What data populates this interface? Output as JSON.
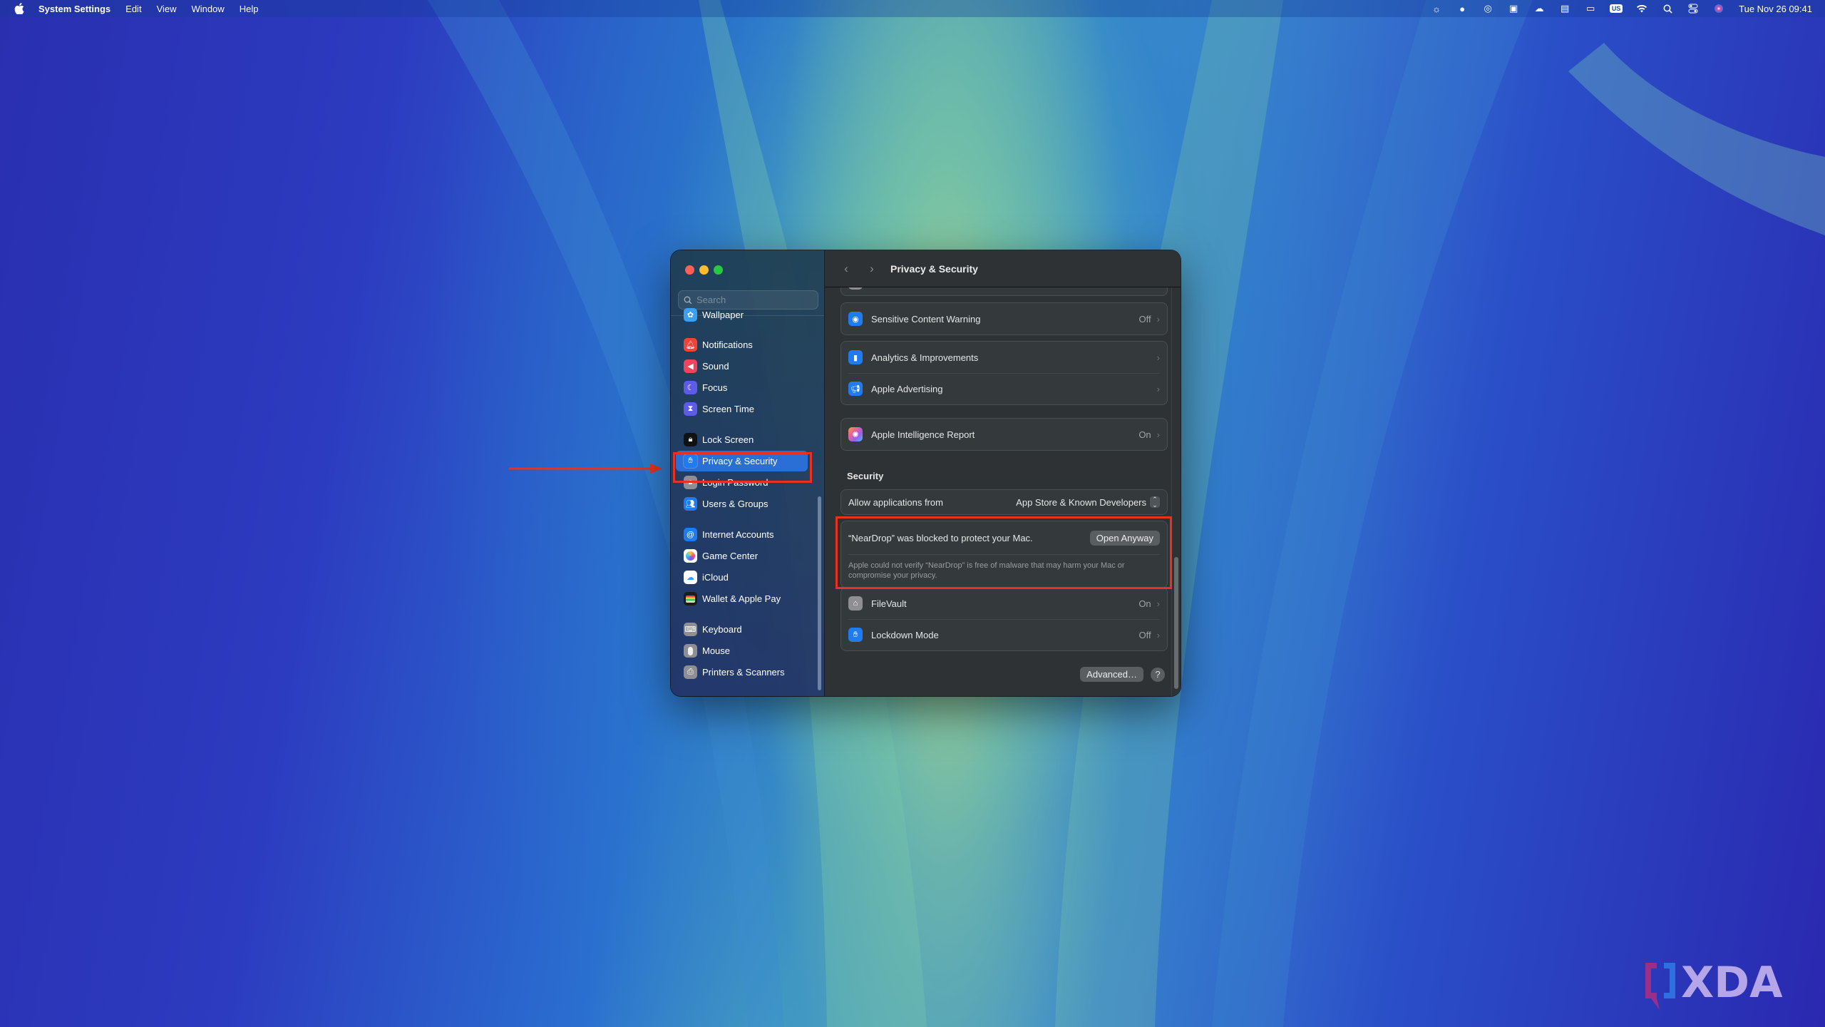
{
  "menubar": {
    "app_name": "System Settings",
    "menus": [
      "Edit",
      "View",
      "Window",
      "Help"
    ],
    "status_icons": [
      "brightness-icon",
      "balloon-icon",
      "creative-cloud-icon",
      "window-layout-icon",
      "onedrive-cloud-icon",
      "drive-icon",
      "display-icon",
      "keyboard-input-us-icon",
      "wifi-icon",
      "spotlight-search-icon",
      "control-center-icon",
      "siri-icon"
    ],
    "input_source": "US",
    "clock": "Tue Nov 26  09:41"
  },
  "window": {
    "title": "Privacy & Security",
    "sidebar": {
      "search_placeholder": "Search",
      "items": [
        {
          "label": "Wallpaper",
          "icon": "wallpaper-icon",
          "color": "#3aa0ef"
        },
        {
          "label": "Notifications",
          "icon": "notifications-icon",
          "color": "#f0443a"
        },
        {
          "label": "Sound",
          "icon": "sound-icon",
          "color": "#f0445e"
        },
        {
          "label": "Focus",
          "icon": "focus-moon-icon",
          "color": "#5e5ce6"
        },
        {
          "label": "Screen Time",
          "icon": "hourglass-icon",
          "color": "#5e5ce6"
        },
        {
          "label": "Lock Screen",
          "icon": "lock-screen-icon",
          "color": "#1c1c1e"
        },
        {
          "label": "Privacy & Security",
          "icon": "hand-icon",
          "color": "#1e7cf0",
          "selected": true
        },
        {
          "label": "Login Password",
          "icon": "lock-icon",
          "color": "#8e8e93"
        },
        {
          "label": "Users & Groups",
          "icon": "users-icon",
          "color": "#1e7cf0"
        },
        {
          "label": "Internet Accounts",
          "icon": "at-sign-icon",
          "color": "#1e7cf0"
        },
        {
          "label": "Game Center",
          "icon": "game-center-icon",
          "color": "#ffffff"
        },
        {
          "label": "iCloud",
          "icon": "icloud-icon",
          "color": "#ffffff"
        },
        {
          "label": "Wallet & Apple Pay",
          "icon": "wallet-icon",
          "color": "#1c1c1e"
        },
        {
          "label": "Keyboard",
          "icon": "keyboard-icon",
          "color": "#8e8e93"
        },
        {
          "label": "Mouse",
          "icon": "mouse-icon",
          "color": "#8e8e93"
        },
        {
          "label": "Printers & Scanners",
          "icon": "printer-icon",
          "color": "#8e8e93"
        }
      ]
    },
    "main": {
      "rows_top": [
        {
          "label": "Sensitive Content Warning",
          "value": "Off",
          "icon": "eye-warning-icon",
          "color": "#1e7cf0"
        }
      ],
      "rows_analytics": [
        {
          "label": "Analytics & Improvements",
          "value": "",
          "icon": "chart-bars-icon",
          "color": "#1e7cf0"
        },
        {
          "label": "Apple Advertising",
          "value": "",
          "icon": "megaphone-icon",
          "color": "#1e7cf0"
        }
      ],
      "rows_intelligence": [
        {
          "label": "Apple Intelligence Report",
          "value": "On",
          "icon": "apple-intelligence-icon",
          "color": "#e8649a"
        }
      ],
      "security_section": {
        "title": "Security",
        "allow_label": "Allow applications from",
        "allow_value": "App Store & Known Developers",
        "blocked_message": "“NearDrop” was blocked to protect your Mac.",
        "open_anyway_label": "Open Anyway",
        "blocked_description": "Apple could not verify “NearDrop” is free of malware that may harm your Mac or compromise your privacy."
      },
      "rows_security": [
        {
          "label": "FileVault",
          "value": "On",
          "icon": "filevault-house-icon",
          "color": "#8e8e93"
        },
        {
          "label": "Lockdown Mode",
          "value": "Off",
          "icon": "hand-icon",
          "color": "#1e7cf0"
        }
      ],
      "advanced_label": "Advanced…",
      "help_label": "?"
    }
  },
  "annotation": {
    "highlight_color": "#e8311f"
  },
  "watermark": "XDA"
}
